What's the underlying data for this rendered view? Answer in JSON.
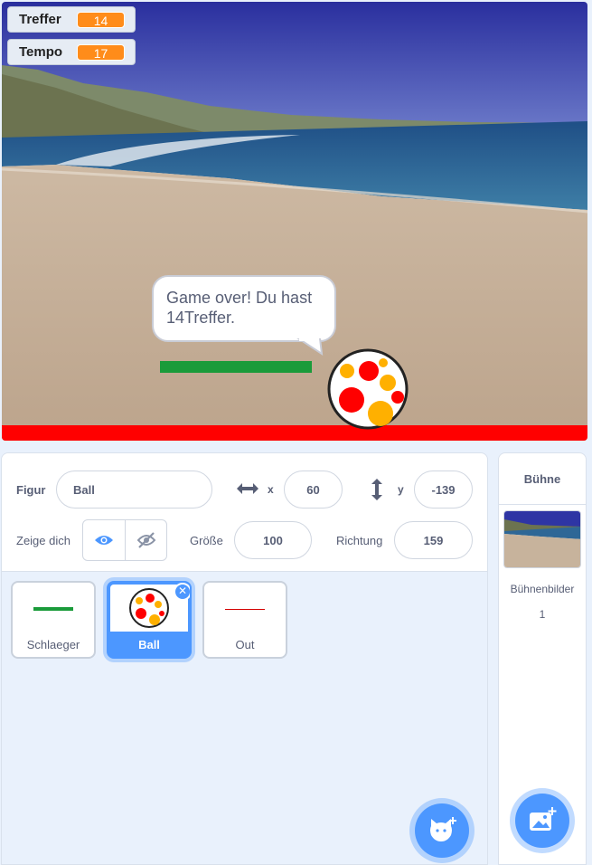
{
  "stage": {
    "monitors": [
      {
        "label": "Treffer",
        "value": "14"
      },
      {
        "label": "Tempo",
        "value": "17"
      }
    ],
    "speech": "Game over! Du hast 14Treffer."
  },
  "sprite_info": {
    "figur_label": "Figur",
    "sprite_name": "Ball",
    "x_label": "x",
    "x_value": "60",
    "y_label": "y",
    "y_value": "-139",
    "show_label": "Zeige dich",
    "size_label": "Größe",
    "size_value": "100",
    "direction_label": "Richtung",
    "direction_value": "159"
  },
  "sprites": [
    {
      "name": "Schlaeger",
      "selected": false
    },
    {
      "name": "Ball",
      "selected": true
    },
    {
      "name": "Out",
      "selected": false
    }
  ],
  "stage_panel": {
    "title": "Bühne",
    "backdrops_label": "Bühnenbilder",
    "backdrops_count": "1"
  },
  "icons": {
    "show": "eye-icon",
    "hide": "eye-slash-icon",
    "x_axis": "horizontal-arrows-icon",
    "y_axis": "vertical-arrows-icon",
    "add_sprite": "cat-plus-icon",
    "add_backdrop": "image-plus-icon",
    "delete": "close-icon"
  },
  "colors": {
    "accent": "#4c97ff",
    "monitor_value": "#ff8c1a",
    "paddle": "#1a9b3a",
    "floor": "#ff0000"
  }
}
